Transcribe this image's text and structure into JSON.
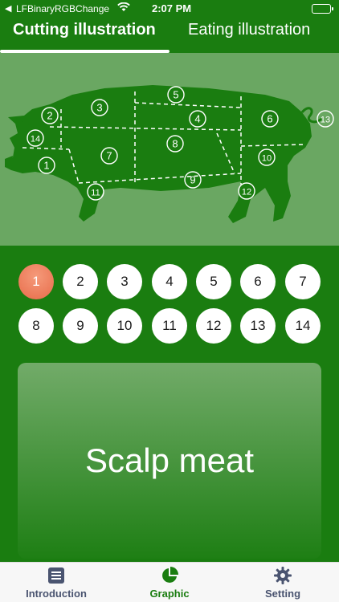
{
  "status_bar": {
    "back_glyph": "◀",
    "carrier": "LFBinaryRGBChange",
    "time": "2:07 PM",
    "wifi_icon": "wifi-icon",
    "battery_level": 1.0
  },
  "top_tabs": [
    {
      "label": "Cutting illustration",
      "active": true
    },
    {
      "label": "Eating illustration",
      "active": false
    }
  ],
  "illustration": {
    "cut_markers": [
      "1",
      "2",
      "3",
      "4",
      "5",
      "6",
      "7",
      "8",
      "9",
      "10",
      "11",
      "12",
      "13",
      "14"
    ]
  },
  "cut_buttons": [
    "1",
    "2",
    "3",
    "4",
    "5",
    "6",
    "7",
    "8",
    "9",
    "10",
    "11",
    "12",
    "13",
    "14"
  ],
  "selected_cut": "1",
  "detail": {
    "name": "Scalp meat"
  },
  "tabbar": [
    {
      "label": "Introduction",
      "icon": "document-list-icon",
      "active": false
    },
    {
      "label": "Graphic",
      "icon": "pie-chart-icon",
      "active": true
    },
    {
      "label": "Setting",
      "icon": "gear-icon",
      "active": false
    }
  ],
  "colors": {
    "primary": "#1a7d10",
    "illustration_bg": "#6aa762",
    "selected_cut": "#e86c4a",
    "tabbar_inactive": "#4a5470"
  }
}
